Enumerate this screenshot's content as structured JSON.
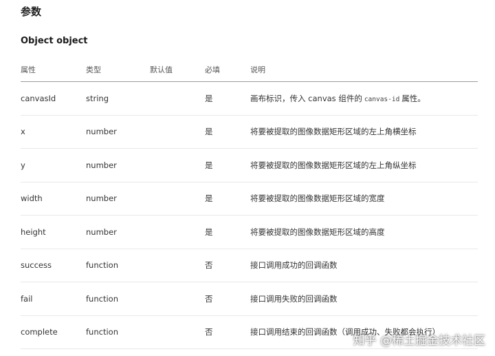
{
  "section_title": "参数",
  "object_title": "Object object",
  "table": {
    "headers": {
      "name": "属性",
      "type": "类型",
      "default": "默认值",
      "required": "必填",
      "description": "说明"
    },
    "rows": [
      {
        "name": "canvasId",
        "type": "string",
        "default": "",
        "required": "是",
        "desc_pre": "画布标识，传入 canvas 组件的",
        "desc_code": "canvas-id",
        "desc_post": "属性。"
      },
      {
        "name": "x",
        "type": "number",
        "default": "",
        "required": "是",
        "desc_pre": "将要被提取的图像数据矩形区域的左上角横坐标",
        "desc_code": "",
        "desc_post": ""
      },
      {
        "name": "y",
        "type": "number",
        "default": "",
        "required": "是",
        "desc_pre": "将要被提取的图像数据矩形区域的左上角纵坐标",
        "desc_code": "",
        "desc_post": ""
      },
      {
        "name": "width",
        "type": "number",
        "default": "",
        "required": "是",
        "desc_pre": "将要被提取的图像数据矩形区域的宽度",
        "desc_code": "",
        "desc_post": ""
      },
      {
        "name": "height",
        "type": "number",
        "default": "",
        "required": "是",
        "desc_pre": "将要被提取的图像数据矩形区域的高度",
        "desc_code": "",
        "desc_post": ""
      },
      {
        "name": "success",
        "type": "function",
        "default": "",
        "required": "否",
        "desc_pre": "接口调用成功的回调函数",
        "desc_code": "",
        "desc_post": ""
      },
      {
        "name": "fail",
        "type": "function",
        "default": "",
        "required": "否",
        "desc_pre": "接口调用失败的回调函数",
        "desc_code": "",
        "desc_post": ""
      },
      {
        "name": "complete",
        "type": "function",
        "default": "",
        "required": "否",
        "desc_pre": "接口调用结束的回调函数（调用成功、失败都会执行）",
        "desc_code": "",
        "desc_post": ""
      }
    ]
  },
  "watermark": "知乎 @稀土掘金技术社区"
}
